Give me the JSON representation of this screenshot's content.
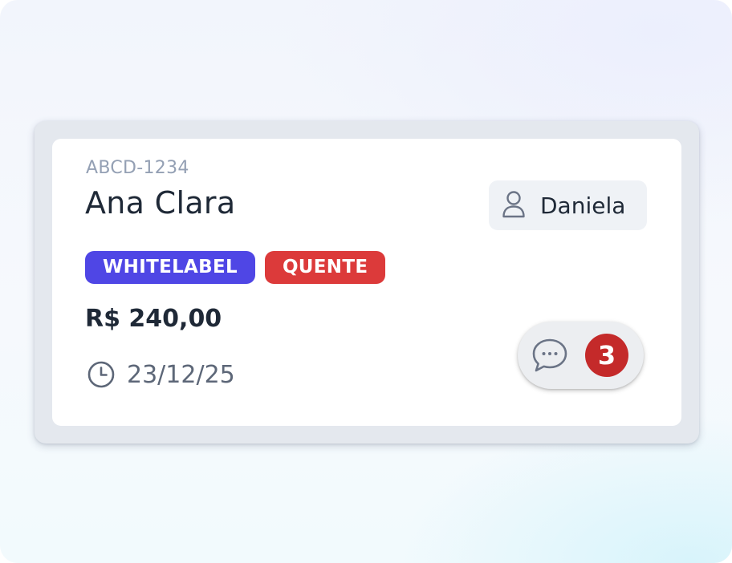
{
  "card": {
    "code": "ABCD-1234",
    "name": "Ana Clara",
    "assignee": {
      "name": "Daniela",
      "icon": "user-icon"
    },
    "tags": [
      {
        "label": "WHITELABEL",
        "color": "#4f46e5"
      },
      {
        "label": "QUENTE",
        "color": "#dc3a3a"
      }
    ],
    "price": "R$ 240,00",
    "date": {
      "icon": "clock-icon",
      "value": "23/12/25"
    },
    "comments": {
      "icon": "chat-bubble-icon",
      "count": "3",
      "badge_color": "#c42a2a"
    }
  }
}
